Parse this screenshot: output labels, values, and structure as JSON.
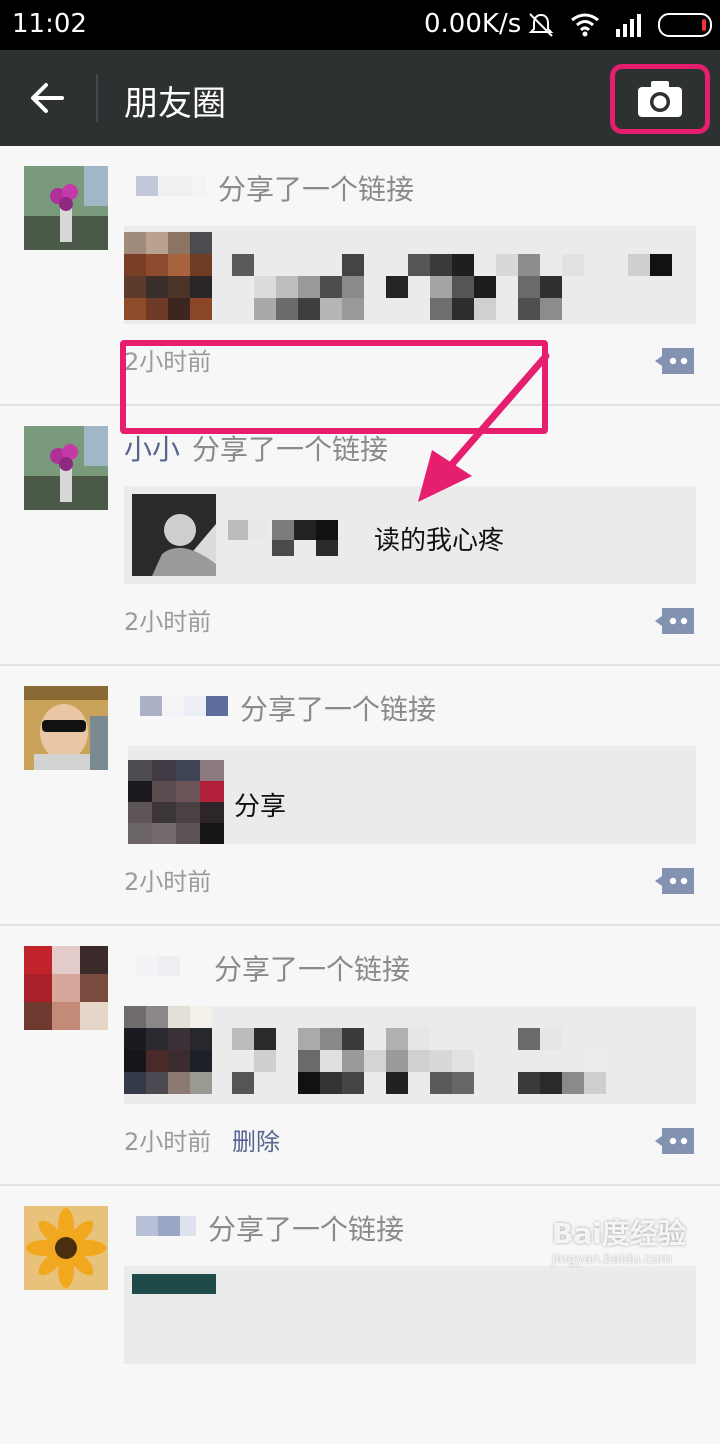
{
  "status_bar": {
    "time": "11:02",
    "net_speed": "0.00K/s"
  },
  "title_bar": {
    "title": "朋友圈"
  },
  "posts": [
    {
      "name": "",
      "action": "分享了一个链接",
      "card_text": "",
      "time": "2小时前"
    },
    {
      "name": "小小",
      "action": "分享了一个链接",
      "card_text": "读的我心疼",
      "time": "2小时前"
    },
    {
      "name": "",
      "action": "分享了一个链接",
      "card_text": "分享",
      "time": "2小时前"
    },
    {
      "name": "",
      "action": "分享了一个链接",
      "card_text": "",
      "time": "2小时前",
      "delete_label": "删除"
    },
    {
      "name": "",
      "action": "分享了一个链接"
    }
  ],
  "watermark": {
    "main": "Bai度经验",
    "sub": "jingyan.baidu.com"
  },
  "colors": {
    "accent_annotation": "#e61e6e",
    "link_blue": "#56668f",
    "title_bar": "#2e3132"
  }
}
